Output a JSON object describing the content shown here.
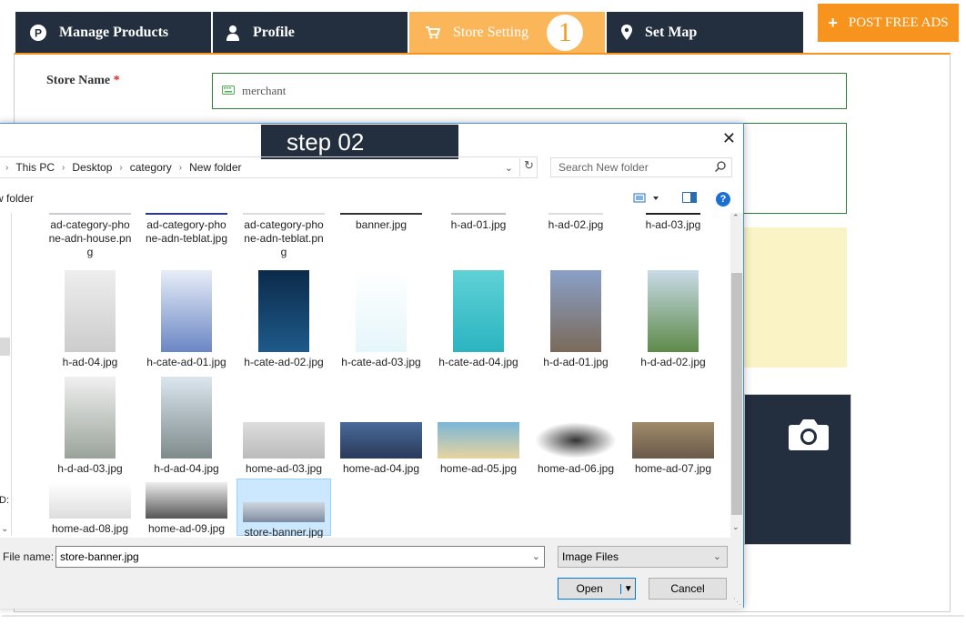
{
  "tabs": [
    {
      "label": "Manage Products",
      "icon": "p-circle-icon"
    },
    {
      "label": "Profile",
      "icon": "user-icon"
    },
    {
      "label": "Store Setting",
      "icon": "cart-icon",
      "badge": "1",
      "active": true
    },
    {
      "label": "Set Map",
      "icon": "map-marker-icon"
    }
  ],
  "post_button": {
    "label": "POST FREE ADS",
    "icon": "plus-icon"
  },
  "form": {
    "store_name_label": "Store Name",
    "required_mark": "*",
    "store_name_value": "merchant",
    "input_icon": "keyboard-icon",
    "camera_icon": "camera-icon"
  },
  "dialog": {
    "step_label": "step 02",
    "close_label": "✕",
    "breadcrumb": [
      "This PC",
      "Desktop",
      "category",
      "New folder"
    ],
    "search_placeholder": "Search New folder",
    "new_folder_label": "w folder",
    "help_label": "?",
    "files": [
      {
        "name": "ad-category-pho\nne-adn-house.pn\ng"
      },
      {
        "name": "ad-category-pho\nne-adn-teblat.jpg"
      },
      {
        "name": "ad-category-pho\nne-adn-teblat.pn\ng"
      },
      {
        "name": "banner.jpg"
      },
      {
        "name": "h-ad-01.jpg"
      },
      {
        "name": "h-ad-02.jpg"
      },
      {
        "name": "h-ad-03.jpg"
      },
      {
        "name": "h-ad-04.jpg"
      },
      {
        "name": "h-cate-ad-01.jpg"
      },
      {
        "name": "h-cate-ad-02.jpg"
      },
      {
        "name": "h-cate-ad-03.jpg"
      },
      {
        "name": "h-cate-ad-04.jpg"
      },
      {
        "name": "h-d-ad-01.jpg"
      },
      {
        "name": "h-d-ad-02.jpg"
      },
      {
        "name": "h-d-ad-03.jpg"
      },
      {
        "name": "h-d-ad-04.jpg"
      },
      {
        "name": "home-ad-03.jpg"
      },
      {
        "name": "home-ad-04.jpg"
      },
      {
        "name": "home-ad-05.jpg"
      },
      {
        "name": "home-ad-06.jpg"
      },
      {
        "name": "home-ad-07.jpg"
      },
      {
        "name": "home-ad-08.jpg"
      },
      {
        "name": "home-ad-09.jpg"
      },
      {
        "name": "store-banner.jpg",
        "selected": true
      }
    ],
    "file_name_label": "File name:",
    "file_name_value": "store-banner.jpg",
    "file_type_value": "Image Files",
    "open_label": "Open",
    "cancel_label": "Cancel",
    "left_edge_text": "D:"
  },
  "colors": {
    "nav_dark": "#232e3e",
    "accent_orange": "#f7941d",
    "active_tab": "#fbb65a",
    "input_border": "#2e7d32"
  }
}
